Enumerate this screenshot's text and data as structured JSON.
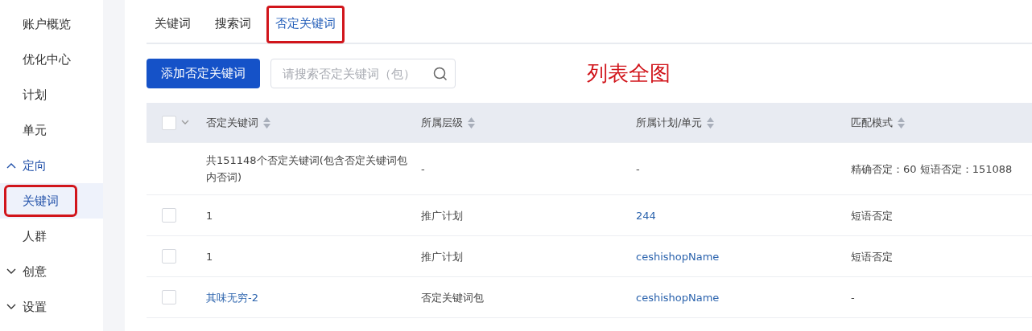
{
  "sidebar": {
    "items": [
      {
        "label": "账户概览",
        "selected": false
      },
      {
        "label": "优化中心",
        "selected": false
      },
      {
        "label": "计划",
        "selected": false
      },
      {
        "label": "单元",
        "selected": false
      },
      {
        "label": "定向",
        "expanded": true,
        "children": [
          {
            "label": "关键词",
            "selected": true,
            "highlighted": true
          },
          {
            "label": "人群",
            "selected": false,
            "highlighted": false
          }
        ]
      },
      {
        "label": "创意",
        "expanded": false
      },
      {
        "label": "设置",
        "expanded": false
      }
    ]
  },
  "tabs": [
    {
      "label": "关键词",
      "selected": false,
      "highlighted": false
    },
    {
      "label": "搜索词",
      "selected": false,
      "highlighted": false
    },
    {
      "label": "否定关键词",
      "selected": true,
      "highlighted": true
    }
  ],
  "add_button": "添加否定关键词",
  "search": {
    "placeholder": "请搜索否定关键词（包）"
  },
  "annotation": "列表全图",
  "table": {
    "columns": [
      "否定关键词",
      "所属层级",
      "所属计划/单元",
      "匹配模式"
    ],
    "select_all": {
      "checked": false
    },
    "rows": [
      {
        "kind": "summary",
        "cells": [
          {
            "text": "共151148个否定关键词(包含否定关键词包内否词)",
            "link": false
          },
          {
            "text": "-",
            "link": false
          },
          {
            "text": "-",
            "link": false
          },
          {
            "text": "精确否定：60 短语否定：151088",
            "link": false
          }
        ]
      },
      {
        "kind": "item",
        "checked": false,
        "cells": [
          {
            "text": "1",
            "link": false
          },
          {
            "text": "推广计划",
            "link": false
          },
          {
            "text": "244",
            "link": true
          },
          {
            "text": "短语否定",
            "link": false
          }
        ]
      },
      {
        "kind": "item",
        "checked": false,
        "cells": [
          {
            "text": "1",
            "link": false
          },
          {
            "text": "推广计划",
            "link": false
          },
          {
            "text": "ceshishopName",
            "link": true
          },
          {
            "text": "短语否定",
            "link": false
          }
        ]
      },
      {
        "kind": "item",
        "checked": false,
        "cells": [
          {
            "text": "其味无穷-2",
            "link": true
          },
          {
            "text": "否定关键词包",
            "link": false
          },
          {
            "text": "ceshishopName",
            "link": true
          },
          {
            "text": "-",
            "link": false
          }
        ]
      }
    ]
  }
}
